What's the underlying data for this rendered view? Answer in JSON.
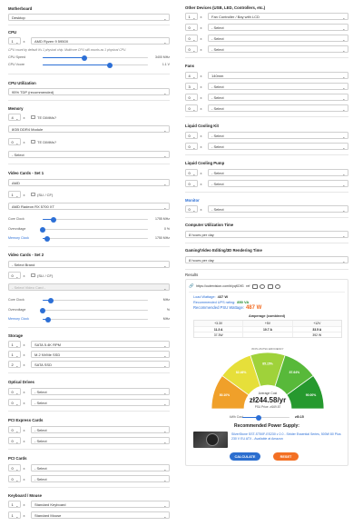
{
  "left": {
    "motherboard": {
      "title": "Motherboard",
      "value": "Desktop"
    },
    "cpu": {
      "title": "CPU",
      "qty": "1",
      "x": "x",
      "value": "AMD Ryzen 9 5950X",
      "note": "CPU count by default it's 1 physical chip. Multicore CPU still counts as 1 physical CPU.",
      "speed_label": "CPU Speed",
      "speed_value": "3400 MHz",
      "speed_level": 0.4,
      "vcore_label": "CPU Vcore",
      "vcore_value": "1.1 V",
      "vcore_level": 0.64
    },
    "utilization": {
      "title": "CPU Utilization",
      "value": "95% TDP (recommended)"
    },
    "memory": {
      "title": "Memory",
      "rows": [
        {
          "qty": "4",
          "x": "x",
          "cb_label": "TE DIMMs?",
          "value": "8GB DDR4 Module"
        },
        {
          "qty": "0",
          "x": "x",
          "cb_label": "TE DIMMs?",
          "value": "- Select"
        }
      ]
    },
    "video1": {
      "title": "Video Cards - Set 1",
      "brand": "AMD",
      "qty": "1",
      "x": "x",
      "cb_label": "(SLI / CF)",
      "model": "AMD Radeon RX 5700 XT",
      "sliders": [
        {
          "label": "Core Clock",
          "value": "1755 MHz",
          "level": 0.1,
          "blue": false
        },
        {
          "label": "Overvoltage",
          "value": "0 %",
          "level": 0.0,
          "blue": false
        },
        {
          "label": "Memory Clock",
          "value": "1750 MHz",
          "level": 0.04,
          "blue": true
        }
      ]
    },
    "video2": {
      "title": "Video Cards - Set 2",
      "brand": "- Select Brand",
      "qty": "0",
      "x": "x",
      "cb_label": "(SLI / CF)",
      "model": "- Select Video Card -",
      "sliders": [
        {
          "label": "Core Clock",
          "value": "MHz",
          "level": 0.08,
          "blue": false
        },
        {
          "label": "Overvoltage",
          "value": "%",
          "level": 0.0,
          "blue": false
        },
        {
          "label": "Memory Clock",
          "value": "MHz",
          "level": 0.05,
          "blue": true
        }
      ]
    },
    "storage": {
      "title": "Storage",
      "rows": [
        {
          "qty": "1",
          "x": "x",
          "value": "SATA 5.4K RPM"
        },
        {
          "qty": "1",
          "x": "x",
          "value": "M.2 NVMe SSD"
        },
        {
          "qty": "2",
          "x": "x",
          "value": "SATA SSD"
        }
      ]
    },
    "optical": {
      "title": "Optical Drives",
      "rows": [
        {
          "qty": "0",
          "x": "x",
          "value": "- Select"
        },
        {
          "qty": "0",
          "x": "x",
          "value": "- Select"
        }
      ]
    },
    "pcie": {
      "title": "PCI Express Cards",
      "rows": [
        {
          "qty": "0",
          "x": "x",
          "value": "- Select"
        },
        {
          "qty": "0",
          "x": "x",
          "value": "- Select"
        }
      ]
    },
    "pci": {
      "title": "PCI Cards",
      "rows": [
        {
          "qty": "0",
          "x": "x",
          "value": "- Select"
        },
        {
          "qty": "0",
          "x": "x",
          "value": "- Select"
        }
      ]
    },
    "keyboard": {
      "title": "Keyboard / Mouse",
      "rows": [
        {
          "qty": "1",
          "x": "x",
          "value": "Standard Keyboard"
        },
        {
          "qty": "1",
          "x": "x",
          "value": "Standard Mouse"
        }
      ]
    }
  },
  "right": {
    "other": {
      "title": "Other Devices (USB, LED, Controllers, etc.)",
      "rows": [
        {
          "qty": "1",
          "x": "x",
          "value": "Fan Controller / Bay with LCD"
        },
        {
          "qty": "0",
          "x": "x",
          "value": "- Select"
        },
        {
          "qty": "0",
          "x": "x",
          "value": "- Select"
        },
        {
          "qty": "0",
          "x": "x",
          "value": "- Select"
        }
      ]
    },
    "fans": {
      "title": "Fans",
      "rows": [
        {
          "qty": "4",
          "x": "x",
          "value": "140mm"
        },
        {
          "qty": "3",
          "x": "x",
          "value": "- Select"
        },
        {
          "qty": "0",
          "x": "x",
          "value": "- Select"
        },
        {
          "qty": "0",
          "x": "x",
          "value": "- Select"
        }
      ]
    },
    "liquid_kit": {
      "title": "Liquid Cooling Kit",
      "rows": [
        {
          "qty": "0",
          "x": "x",
          "value": "- Select"
        },
        {
          "qty": "0",
          "x": "x",
          "value": "- Select"
        }
      ]
    },
    "liquid_pump": {
      "title": "Liquid Cooling Pump",
      "rows": [
        {
          "qty": "0",
          "x": "x",
          "value": "- Select"
        },
        {
          "qty": "0",
          "x": "x",
          "value": "- Select"
        }
      ]
    },
    "monitor": {
      "title": "Monitor",
      "rows": [
        {
          "qty": "0",
          "x": "x",
          "value": "- Select"
        }
      ]
    },
    "comp_time": {
      "title": "Computer Utilization Time",
      "value": "8 hours per day"
    },
    "gaming_time": {
      "title": "Gaming/Video Editing/3D Rendering Time",
      "value": "8 hours per day"
    },
    "results": {
      "title": "Results",
      "url": "https://outervision.com/b/yqKDfG",
      "url_short": "ref",
      "share_icons": [
        "link-icon",
        "tag-icon",
        "forum-icon",
        "reddit-icon",
        "share-icon"
      ],
      "load_label": "Load Wattage:",
      "load_value": "437 W",
      "ups_label": "Recommended UPS rating:",
      "ups_value": "850 VA",
      "psu_label": "Recommended PSU Wattage:",
      "psu_value": "487 W",
      "amperage": {
        "title": "Amperage (combined)",
        "headers": [
          "+3.3V",
          "+5V",
          "+12V"
        ],
        "row1": [
          "11.3 A",
          "10.7 A",
          "33.5 A"
        ],
        "row2_left": "37.3W",
        "row2_right": "392 W"
      },
      "gauge": {
        "top_label": "80 PLUS PSU EFFICIENCY",
        "center_label": "Average Cost",
        "center_value": "zł244.58/yr",
        "segments": [
          {
            "label": "80.10%",
            "color": "#f0a02a"
          },
          {
            "label": "82.46%",
            "color": "#e6df3a"
          },
          {
            "label": "85.15%",
            "color": "#9fd23a"
          },
          {
            "label": "87.64%",
            "color": "#58b93a"
          },
          {
            "label": "90.00%",
            "color": "#26992e"
          }
        ],
        "sub_label": "PSU Price:",
        "sub_value": "zł169.87"
      },
      "cost_label": "kWh Cost",
      "cost_value": "zł0.15",
      "cost_level": 0.35,
      "recommended_title": "Recommended Power Supply:",
      "recommended_text": "SilverStone SST-ST50F-ES230 v 2.0 - Strider Essential Series, 500W 80 Plus 230 V EU ATX - Available at Amazon",
      "calculate_label": "CALCULATE",
      "reset_label": "RESET"
    }
  },
  "colors": {
    "accent": "#2c6fd6",
    "orange": "#f26b21",
    "green": "#1e8a2e",
    "red": "#e64b2a",
    "calc": "#2b6ecf",
    "reset": "#f37024"
  }
}
